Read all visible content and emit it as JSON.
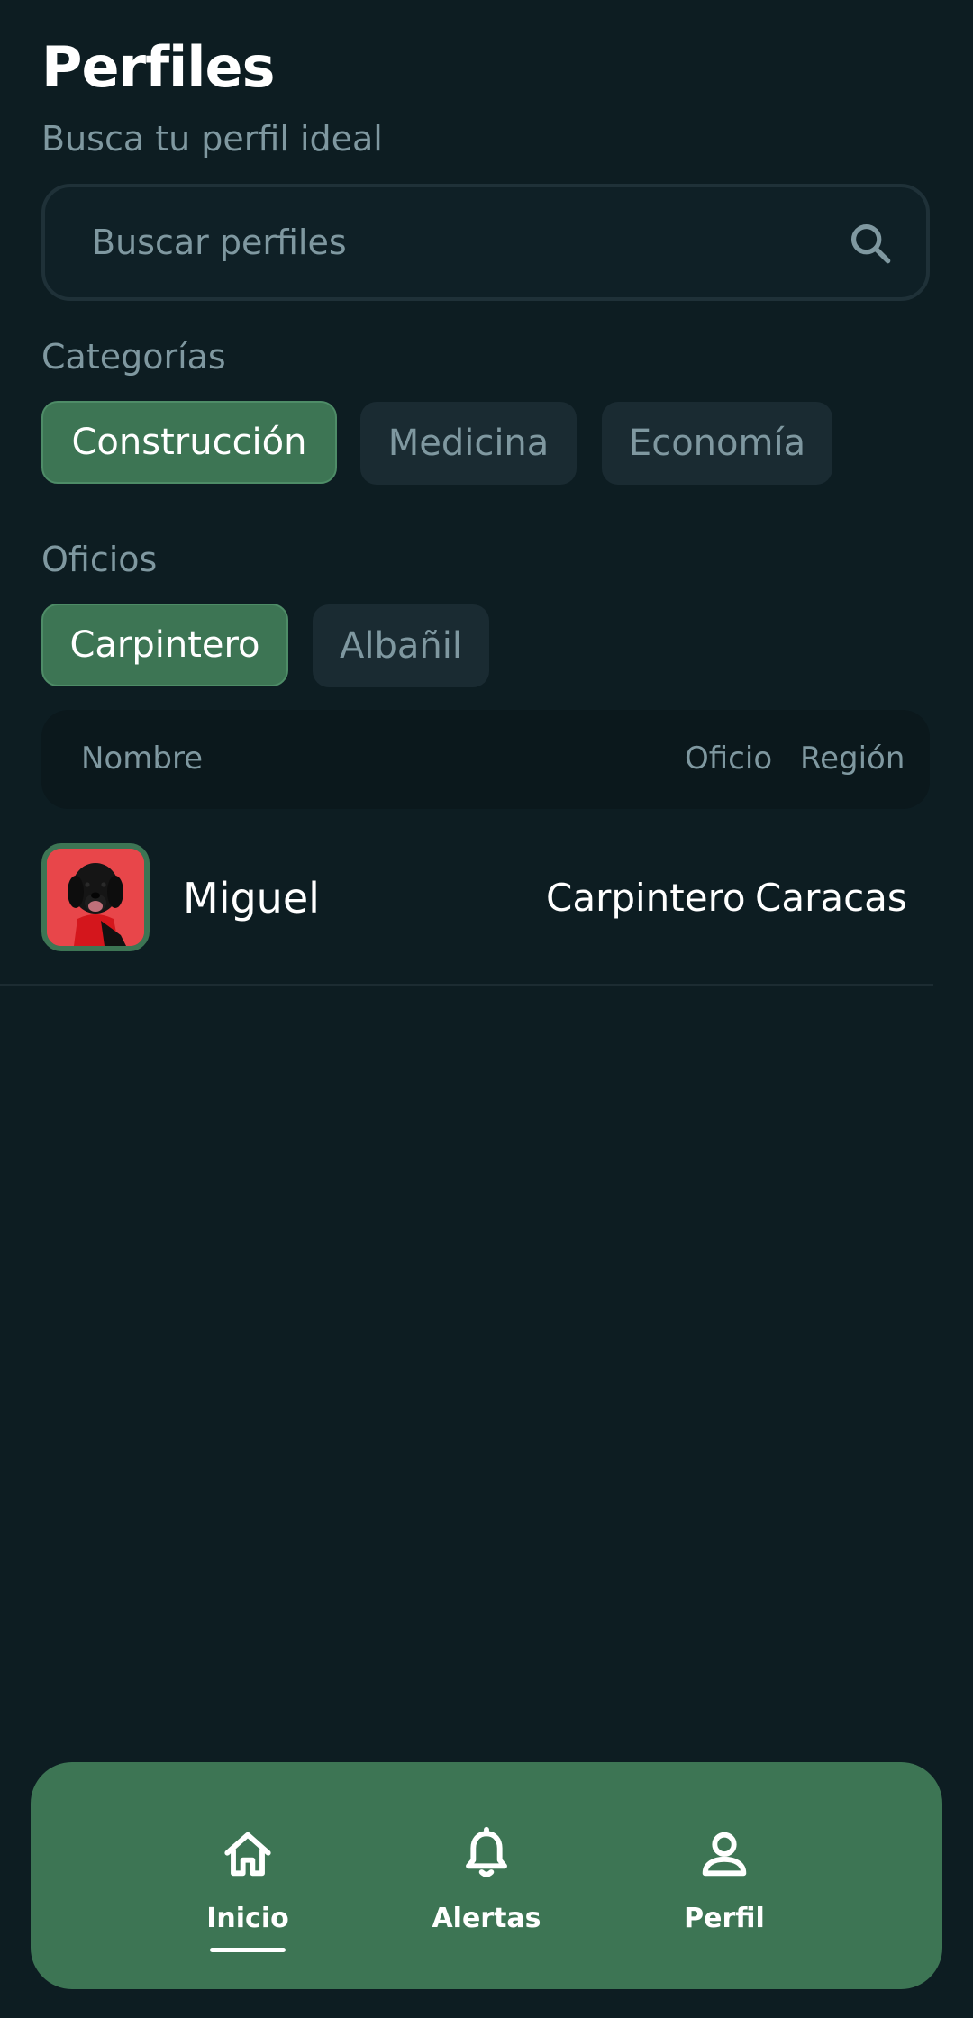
{
  "header": {
    "title": "Perfiles",
    "subtitle": "Busca tu perfil ideal"
  },
  "search": {
    "placeholder": "Buscar perfiles",
    "value": "",
    "icon": "search-icon"
  },
  "categories": {
    "label": "Categorías",
    "items": [
      {
        "label": "Construcción",
        "selected": true
      },
      {
        "label": "Medicina",
        "selected": false
      },
      {
        "label": "Economía",
        "selected": false
      }
    ]
  },
  "trades": {
    "label": "Oficios",
    "items": [
      {
        "label": "Carpintero",
        "selected": true
      },
      {
        "label": "Albañil",
        "selected": false
      }
    ]
  },
  "table": {
    "headers": {
      "name": "Nombre",
      "trade": "Oficio",
      "region": "Región"
    },
    "rows": [
      {
        "name": "Miguel",
        "trade": "Carpintero",
        "region": "Caracas",
        "avatar": "dog-photo"
      }
    ]
  },
  "bottom_nav": {
    "items": [
      {
        "label": "Inicio",
        "icon": "home-icon",
        "active": true
      },
      {
        "label": "Alertas",
        "icon": "bell-icon",
        "active": false
      },
      {
        "label": "Perfil",
        "icon": "person-icon",
        "active": false
      }
    ]
  },
  "colors": {
    "background": "#0d1d22",
    "accent": "#3d7554",
    "muted_text": "#7f98a0",
    "chip_inactive": "#1a2b32"
  }
}
